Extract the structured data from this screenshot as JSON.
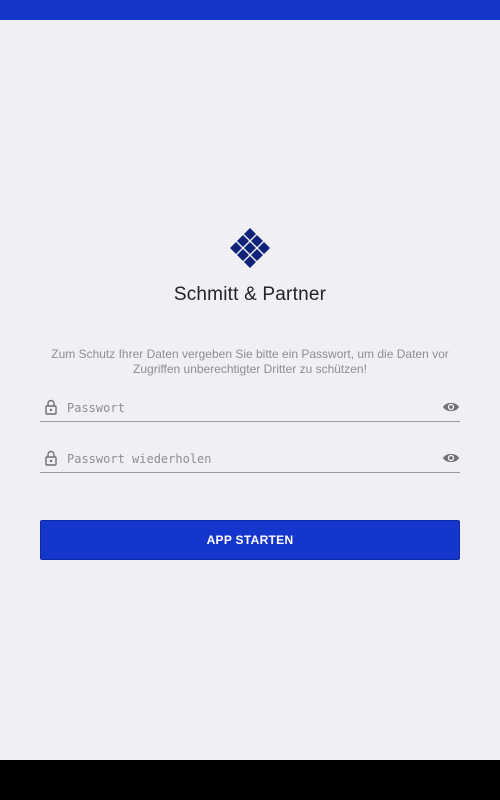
{
  "brand": {
    "name": "Schmitt & Partner",
    "logo_icon": "diamond-cluster-logo",
    "logo_color": "#0f2378"
  },
  "intro_text": "Zum Schutz Ihrer Daten vergeben Sie bitte ein Passwort, um die Daten vor Zugriffen unberechtigter Dritter zu schützen!",
  "form": {
    "password": {
      "placeholder": "Passwort",
      "value": "",
      "icon": "lock-icon",
      "toggle_icon": "eye-icon"
    },
    "password_repeat": {
      "placeholder": "Passwort wiederholen",
      "value": "",
      "icon": "lock-icon",
      "toggle_icon": "eye-icon"
    },
    "submit_label": "APP STARTEN"
  },
  "colors": {
    "status_bar": "#1535c8",
    "accent": "#1536cc",
    "background": "#f0eff4",
    "navigation_bar": "#000000"
  }
}
